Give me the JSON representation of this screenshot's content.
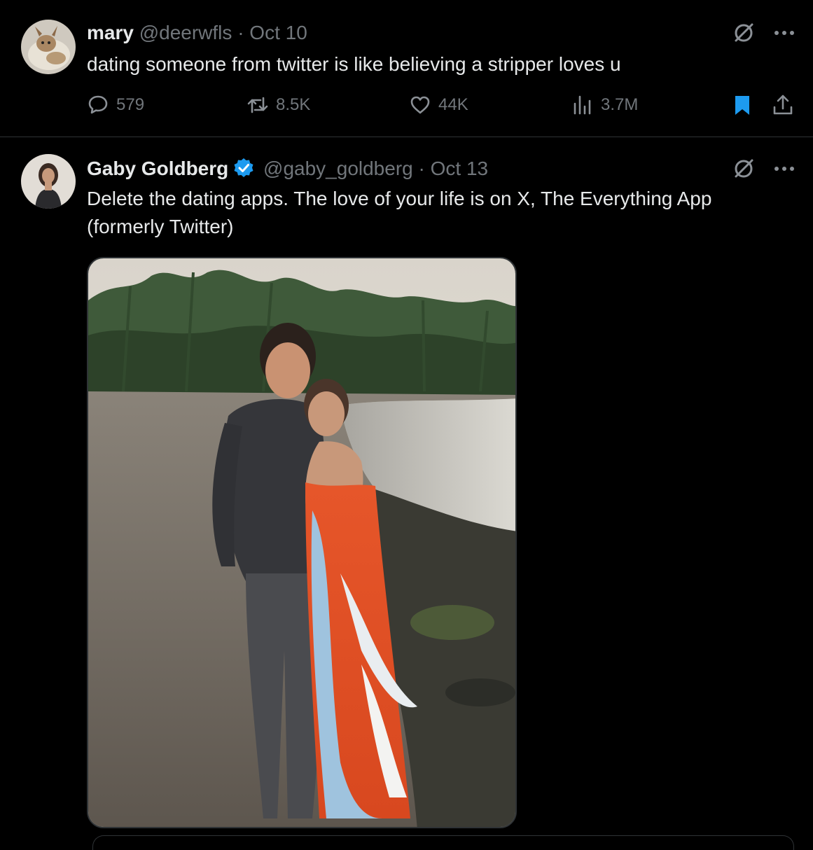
{
  "tweets": [
    {
      "display_name": "mary",
      "handle": "@deerwfls",
      "separator": "·",
      "date": "Oct 10",
      "text": "dating someone from twitter is like believing a stripper loves u",
      "stats": {
        "replies": "579",
        "reposts": "8.5K",
        "likes": "44K",
        "views": "3.7M"
      },
      "icons": [
        "grok-icon",
        "more-icon",
        "reply-icon",
        "repost-icon",
        "like-icon",
        "views-icon",
        "bookmark-icon",
        "share-icon"
      ],
      "bookmarked": true
    },
    {
      "display_name": "Gaby Goldberg",
      "verified": true,
      "handle": "@gaby_goldberg",
      "separator": "·",
      "date": "Oct 13",
      "text": "Delete the dating apps. The love of your life is on X, The Everything App (formerly Twitter)",
      "icons": [
        "grok-icon",
        "more-icon",
        "verified-badge-icon"
      ]
    }
  ],
  "colors": {
    "background": "#000000",
    "text_primary": "#e7e9ea",
    "text_secondary": "#71767b",
    "verified_blue": "#1d9bf0",
    "bookmark_blue": "#1d9bf0",
    "divider": "#2f3336"
  }
}
